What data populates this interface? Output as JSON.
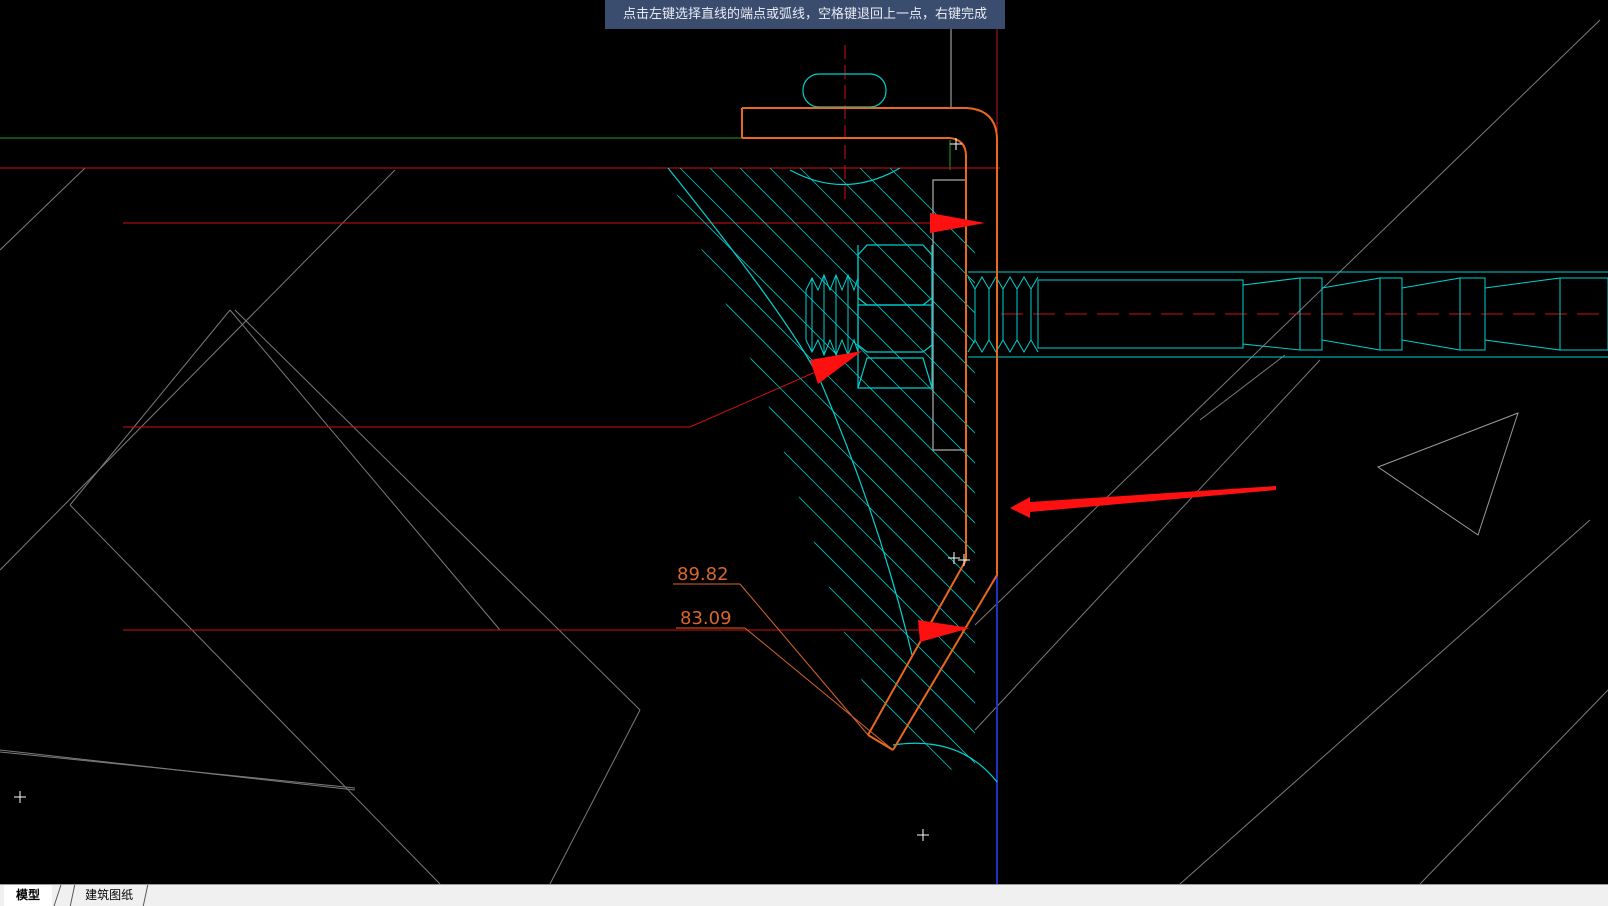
{
  "command_prompt": {
    "text": "点击左键选择直线的端点或弧线，空格键退回上一点，右键完成"
  },
  "dimensions": {
    "first": "89.82",
    "second": "83.09"
  },
  "layout_tabs": [
    {
      "label": "模型",
      "active": true
    },
    {
      "label": "建筑图纸",
      "active": false
    }
  ],
  "colors": {
    "background": "#000000",
    "prompt_bar": "#3b4d6e",
    "profile_orange": "#e8681e",
    "hatch_cyan": "#00d0d0",
    "annotation_red": "#ff0000",
    "dimension_orange": "#d9662b",
    "reference_green": "#1fa01f",
    "axis_blue": "#2030c0",
    "construction_gray": "#9a9a9a"
  }
}
